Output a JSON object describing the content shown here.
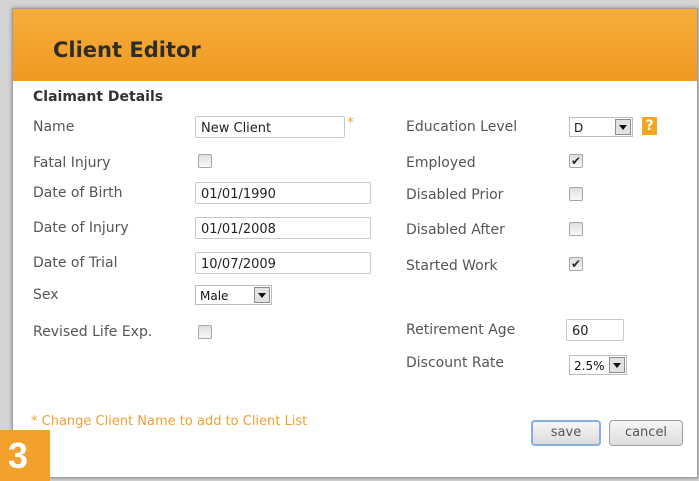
{
  "dialog": {
    "title": "Client Editor",
    "section_title": "Claimant Details"
  },
  "left_fields": {
    "name": {
      "label": "Name",
      "value": "New Client",
      "required_mark": "*"
    },
    "fatal_injury": {
      "label": "Fatal Injury",
      "checked": false
    },
    "date_of_birth": {
      "label": "Date of Birth",
      "value": "01/01/1990"
    },
    "date_of_injury": {
      "label": "Date of Injury",
      "value": "01/01/2008"
    },
    "date_of_trial": {
      "label": "Date of Trial",
      "value": "10/07/2009"
    },
    "sex": {
      "label": "Sex",
      "value": "Male"
    },
    "revised_life_exp": {
      "label": "Revised Life Exp.",
      "checked": false
    }
  },
  "right_fields": {
    "education_level": {
      "label": "Education Level",
      "value": "D",
      "help": "?"
    },
    "employed": {
      "label": "Employed",
      "checked": true
    },
    "disabled_prior": {
      "label": "Disabled Prior",
      "checked": false
    },
    "disabled_after": {
      "label": "Disabled After",
      "checked": false
    },
    "started_work": {
      "label": "Started Work",
      "checked": true
    },
    "retirement_age": {
      "label": "Retirement Age",
      "value": "60"
    },
    "discount_rate": {
      "label": "Discount Rate",
      "value": "2.5%"
    }
  },
  "footer": {
    "note": "* Change Client Name to add to Client List",
    "save_label": "save",
    "cancel_label": "cancel"
  },
  "step_badge": "3",
  "colors": {
    "titlebar": "#f09a22",
    "accent": "#f0a133",
    "save_focus": "#85afe0"
  }
}
